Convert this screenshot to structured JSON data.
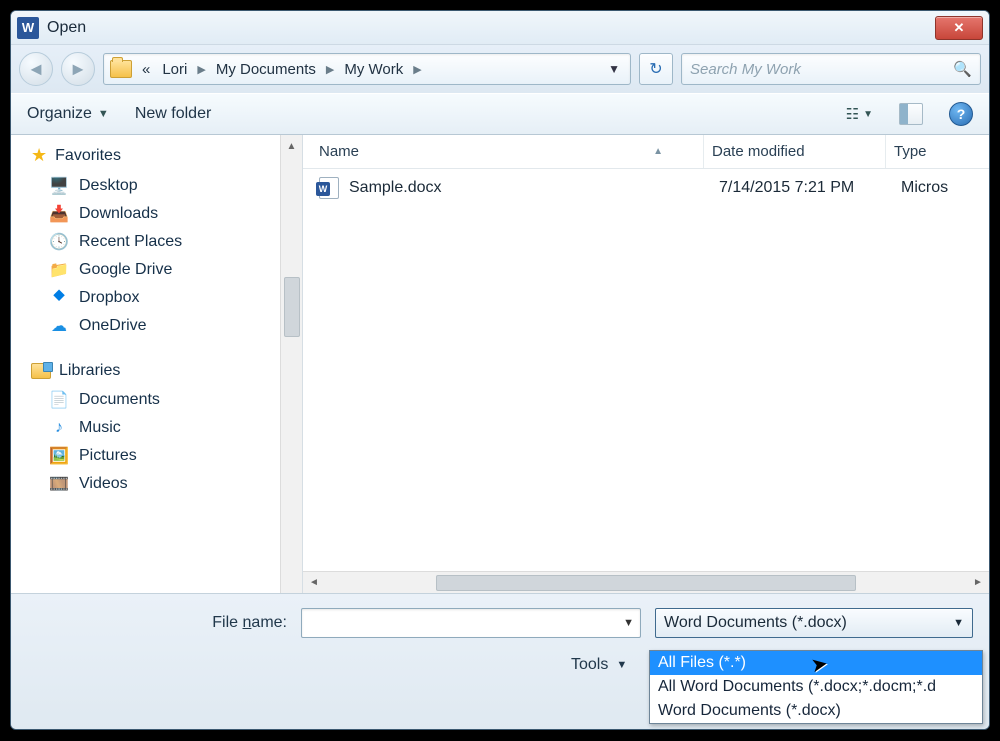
{
  "window": {
    "title": "Open"
  },
  "breadcrumb": {
    "root": "«",
    "segments": [
      "Lori",
      "My Documents",
      "My Work"
    ]
  },
  "search": {
    "placeholder": "Search My Work"
  },
  "toolbar": {
    "organize": "Organize",
    "newfolder": "New folder"
  },
  "sidebar": {
    "favorites": {
      "label": "Favorites",
      "items": [
        "Desktop",
        "Downloads",
        "Recent Places",
        "Google Drive",
        "Dropbox",
        "OneDrive"
      ]
    },
    "libraries": {
      "label": "Libraries",
      "items": [
        "Documents",
        "Music",
        "Pictures",
        "Videos"
      ]
    }
  },
  "columns": {
    "name": "Name",
    "date": "Date modified",
    "type": "Type"
  },
  "files": [
    {
      "name": "Sample.docx",
      "date": "7/14/2015 7:21 PM",
      "type": "Micros"
    }
  ],
  "bottom": {
    "filename_label": "File name:",
    "filename_value": "",
    "filetype_selected": "Word Documents (*.docx)",
    "tools": "Tools"
  },
  "filetype_options": [
    "All Files (*.*)",
    "All Word Documents (*.docx;*.docm;*.d",
    "Word Documents (*.docx)"
  ]
}
